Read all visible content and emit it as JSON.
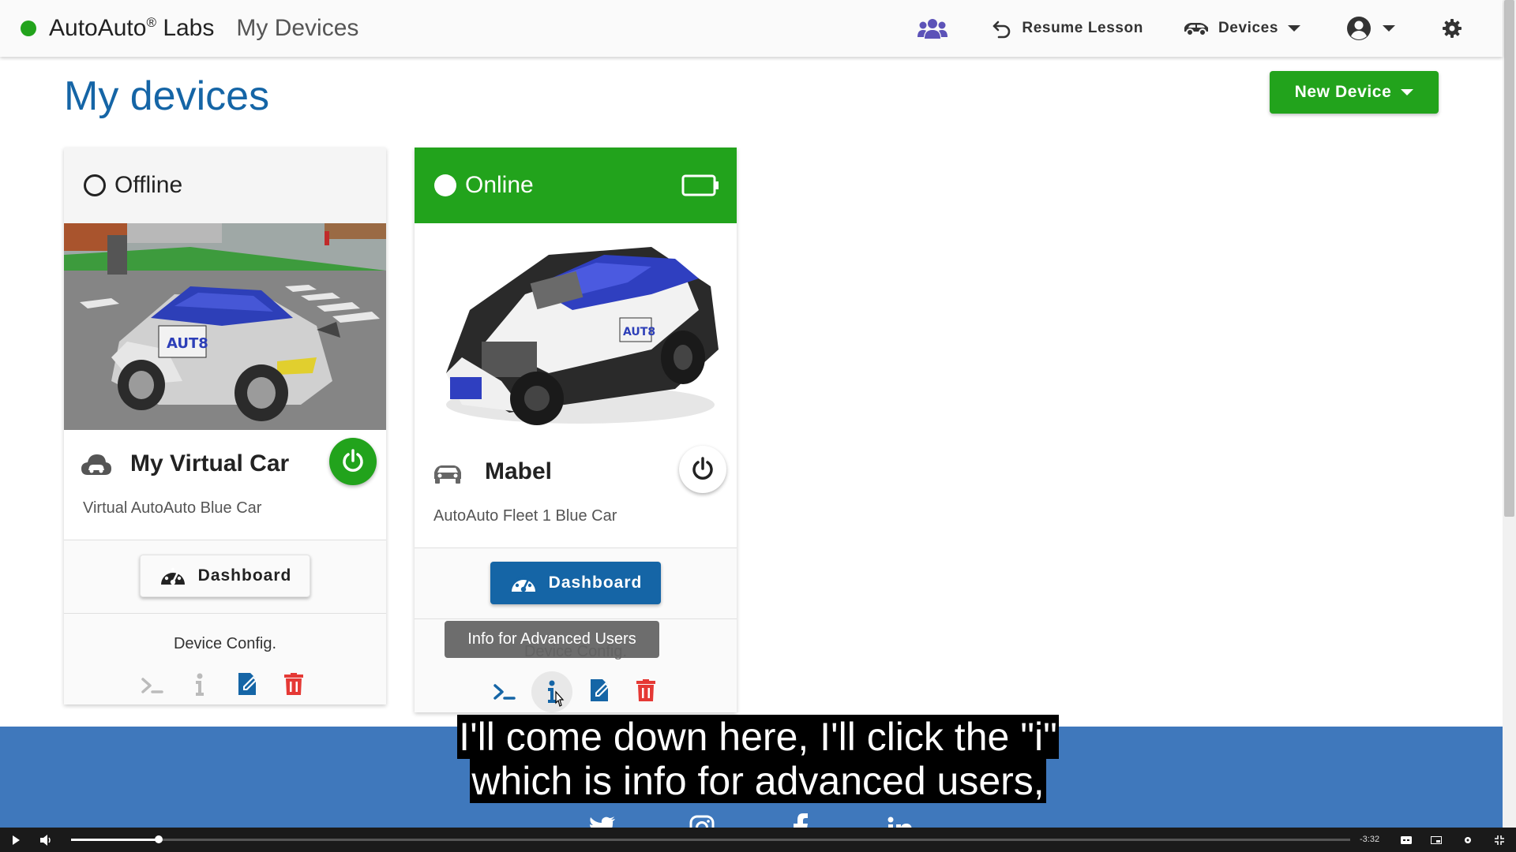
{
  "nav": {
    "brand": "AutoAuto",
    "brand_reg": "®",
    "brand_suffix": "Labs",
    "breadcrumb": "My Devices",
    "resume_lesson": "Resume Lesson",
    "devices": "Devices",
    "brand_color": "#22a31c"
  },
  "page": {
    "title": "My devices",
    "new_device": "New Device"
  },
  "cards": [
    {
      "status": "Offline",
      "name": "My Virtual Car",
      "description": "Virtual AutoAuto Blue Car",
      "dashboard": "Dashboard",
      "config_label": "Device Config.",
      "icon": "cloud-car-icon",
      "powered": true
    },
    {
      "status": "Online",
      "name": "Mabel",
      "description": "AutoAuto Fleet 1 Blue Car",
      "dashboard": "Dashboard",
      "config_label": "Device Config.",
      "icon": "car-icon",
      "powered": false,
      "header_color": "#22a31c"
    }
  ],
  "tooltip": "Info for Advanced Users",
  "caption": {
    "line1": "I'll come down here, I'll click the \"i\"",
    "line2": "which is info for advanced users,"
  },
  "video": {
    "time_remaining": "-3:32"
  },
  "colors": {
    "primary_blue": "#1565a6",
    "green": "#22a31c",
    "delete_red": "#e53935",
    "footer_blue": "#3f78bc"
  }
}
